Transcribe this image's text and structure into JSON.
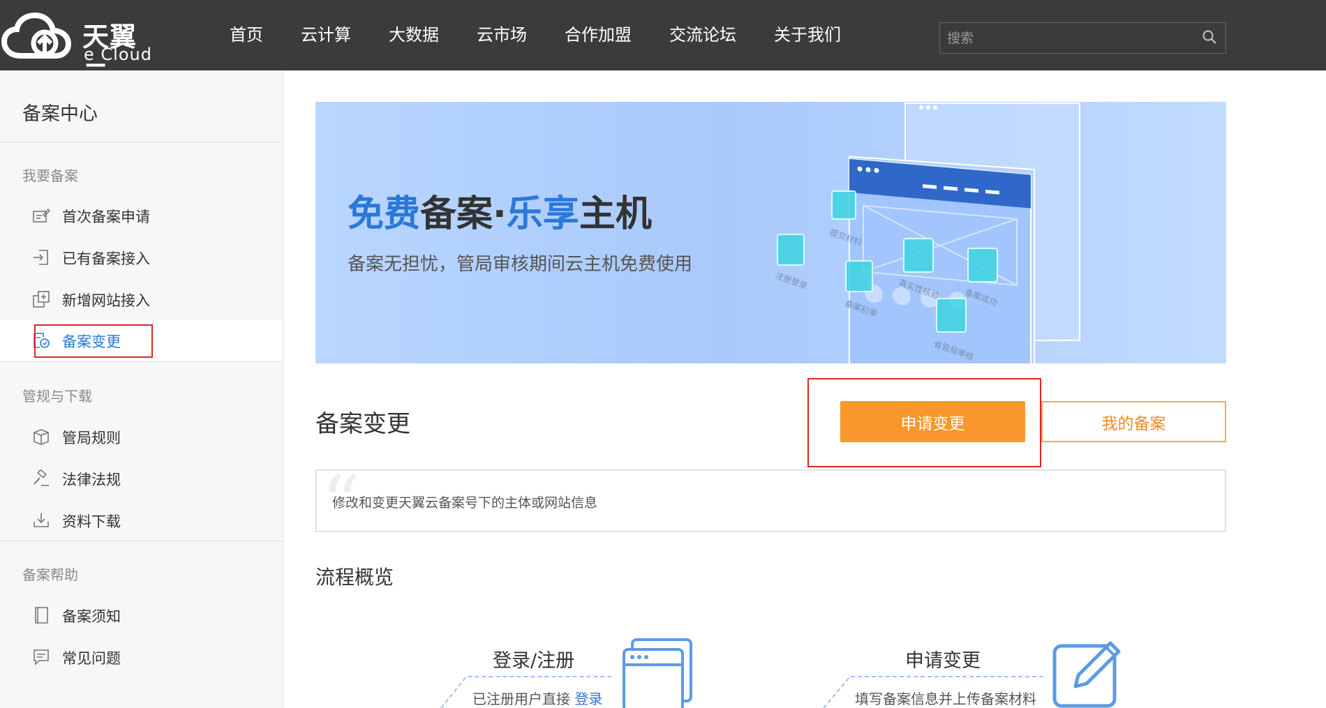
{
  "header": {
    "logo_cn": "天翼云",
    "logo_en": "e Cloud",
    "nav": [
      "首页",
      "云计算",
      "大数据",
      "云市场",
      "合作加盟",
      "交流论坛",
      "关于我们"
    ],
    "search_placeholder": "搜索"
  },
  "sidebar": {
    "title": "备案中心",
    "groups": [
      {
        "label": "我要备案",
        "items": [
          "首次备案申请",
          "已有备案接入",
          "新增网站接入",
          "备案变更"
        ]
      },
      {
        "label": "管规与下载",
        "items": [
          "管局规则",
          "法律法规",
          "资料下载"
        ]
      },
      {
        "label": "备案帮助",
        "items": [
          "备案须知",
          "常见问题"
        ]
      }
    ],
    "active_item": "备案变更"
  },
  "banner": {
    "title_part1": "免费",
    "title_part2": "备案",
    "title_dot": "·",
    "title_part3": "乐享",
    "title_part4": "主机",
    "subtitle": "备案无担忧，管局审核期间云主机免费使用",
    "card_labels": [
      "提交材料",
      "注册登录",
      "备案初审",
      "真实性核验",
      "备案成功",
      "省管局审核"
    ]
  },
  "main": {
    "section_title": "备案变更",
    "apply_button": "申请变更",
    "my_records_button": "我的备案",
    "description": "修改和变更天翼云备案号下的主体或网站信息",
    "flow_title": "流程概览",
    "steps": [
      {
        "title": "登录/注册",
        "sub": "已注册用户直接",
        "link": "登录"
      },
      {
        "title": "申请变更",
        "sub": "填写备案信息并上传备案材料"
      }
    ]
  },
  "colors": {
    "topbar": "#3b3b3b",
    "accent_blue": "#2a78d8",
    "accent_orange": "#f8972b",
    "highlight_red": "#e02424"
  }
}
